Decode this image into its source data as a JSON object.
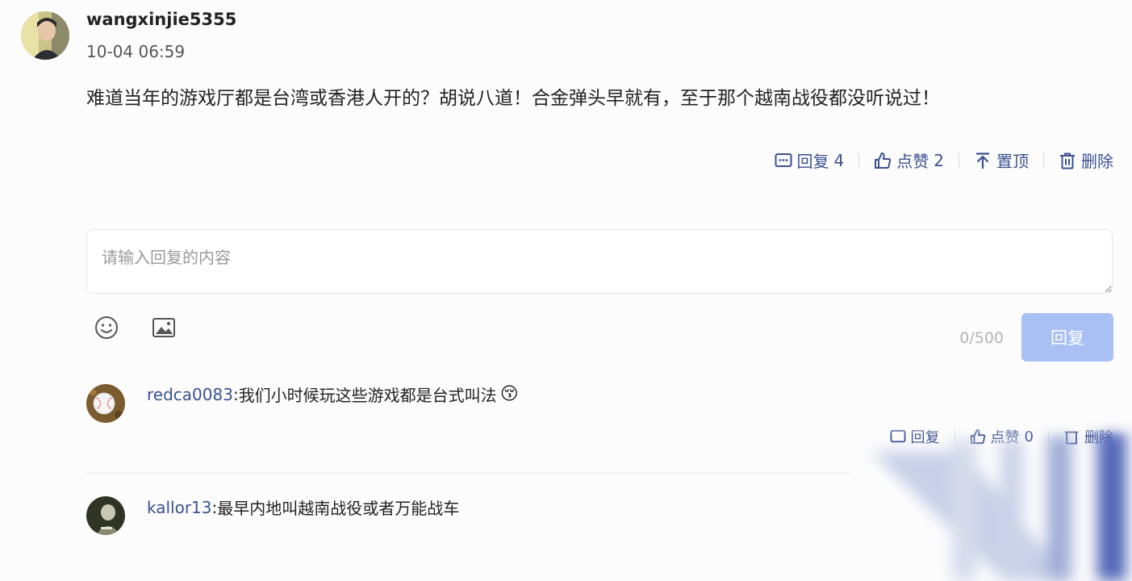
{
  "comment": {
    "username": "wangxinjie5355",
    "timestamp": "10-04 06:59",
    "text": "难道当年的游戏厅都是台湾或香港人开的？胡说八道！合金弹头早就有，至于那个越南战役都没听说过！",
    "actions": {
      "reply_label": "回复",
      "reply_count": "4",
      "like_label": "点赞",
      "like_count": "2",
      "pin_label": "置顶",
      "delete_label": "删除"
    }
  },
  "reply_form": {
    "placeholder": "请输入回复的内容",
    "char_count": "0/500",
    "submit_label": "回复"
  },
  "replies": [
    {
      "username": "redca0083",
      "separator": ":",
      "text": "我们小时候玩这些游戏都是台式叫法",
      "emoji": "😚",
      "actions": {
        "reply_label": "回复",
        "like_label": "点赞",
        "like_count": "0",
        "delete_label": "删除"
      }
    },
    {
      "username": "kallor13",
      "separator": ":",
      "text": "最早内地叫越南战役或者万能战车"
    }
  ],
  "colors": {
    "accent": "#3b5190",
    "submit_disabled": "#a9c0f5",
    "background": "#fcfcfd"
  },
  "icons": [
    "comment-icon",
    "thumbs-up-icon",
    "pin-top-icon",
    "trash-icon",
    "emoji-icon",
    "image-icon"
  ]
}
